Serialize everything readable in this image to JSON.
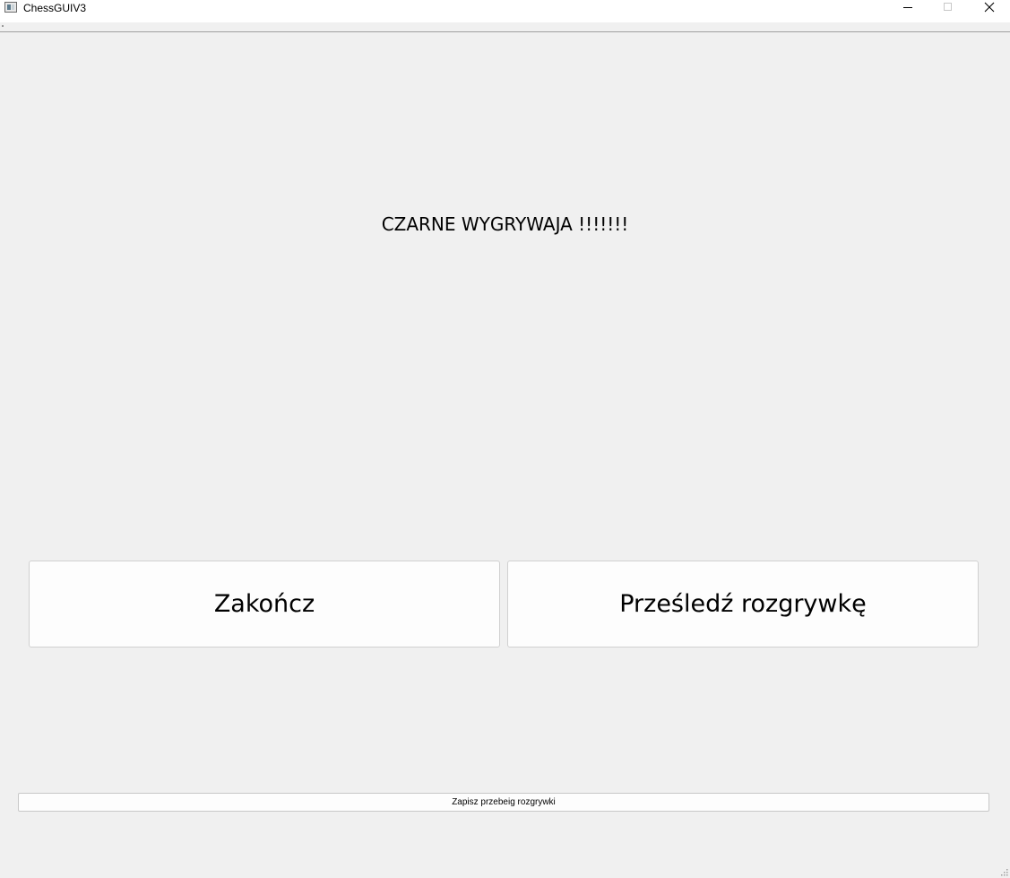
{
  "window": {
    "title": "ChessGUIV3",
    "controls": {
      "minimize": "minimize",
      "maximize": "maximize",
      "close": "close"
    }
  },
  "main": {
    "result_text": "CZARNE WYGRYWAJA !!!!!!!",
    "buttons": {
      "end_label": "Zakończ",
      "replay_label": "Prześledź rozgrywkę"
    },
    "save_label": "Zapisz przebeig rozgrywki"
  },
  "icons": {
    "app": "app-window-icon",
    "minimize": "minimize-icon",
    "maximize": "maximize-icon",
    "close": "close-icon",
    "resize": "resize-grip-icon"
  },
  "colors": {
    "background": "#f0f0f0",
    "titlebar": "#ffffff",
    "button_face": "#fdfdfd",
    "button_border": "#d0d0d0"
  }
}
